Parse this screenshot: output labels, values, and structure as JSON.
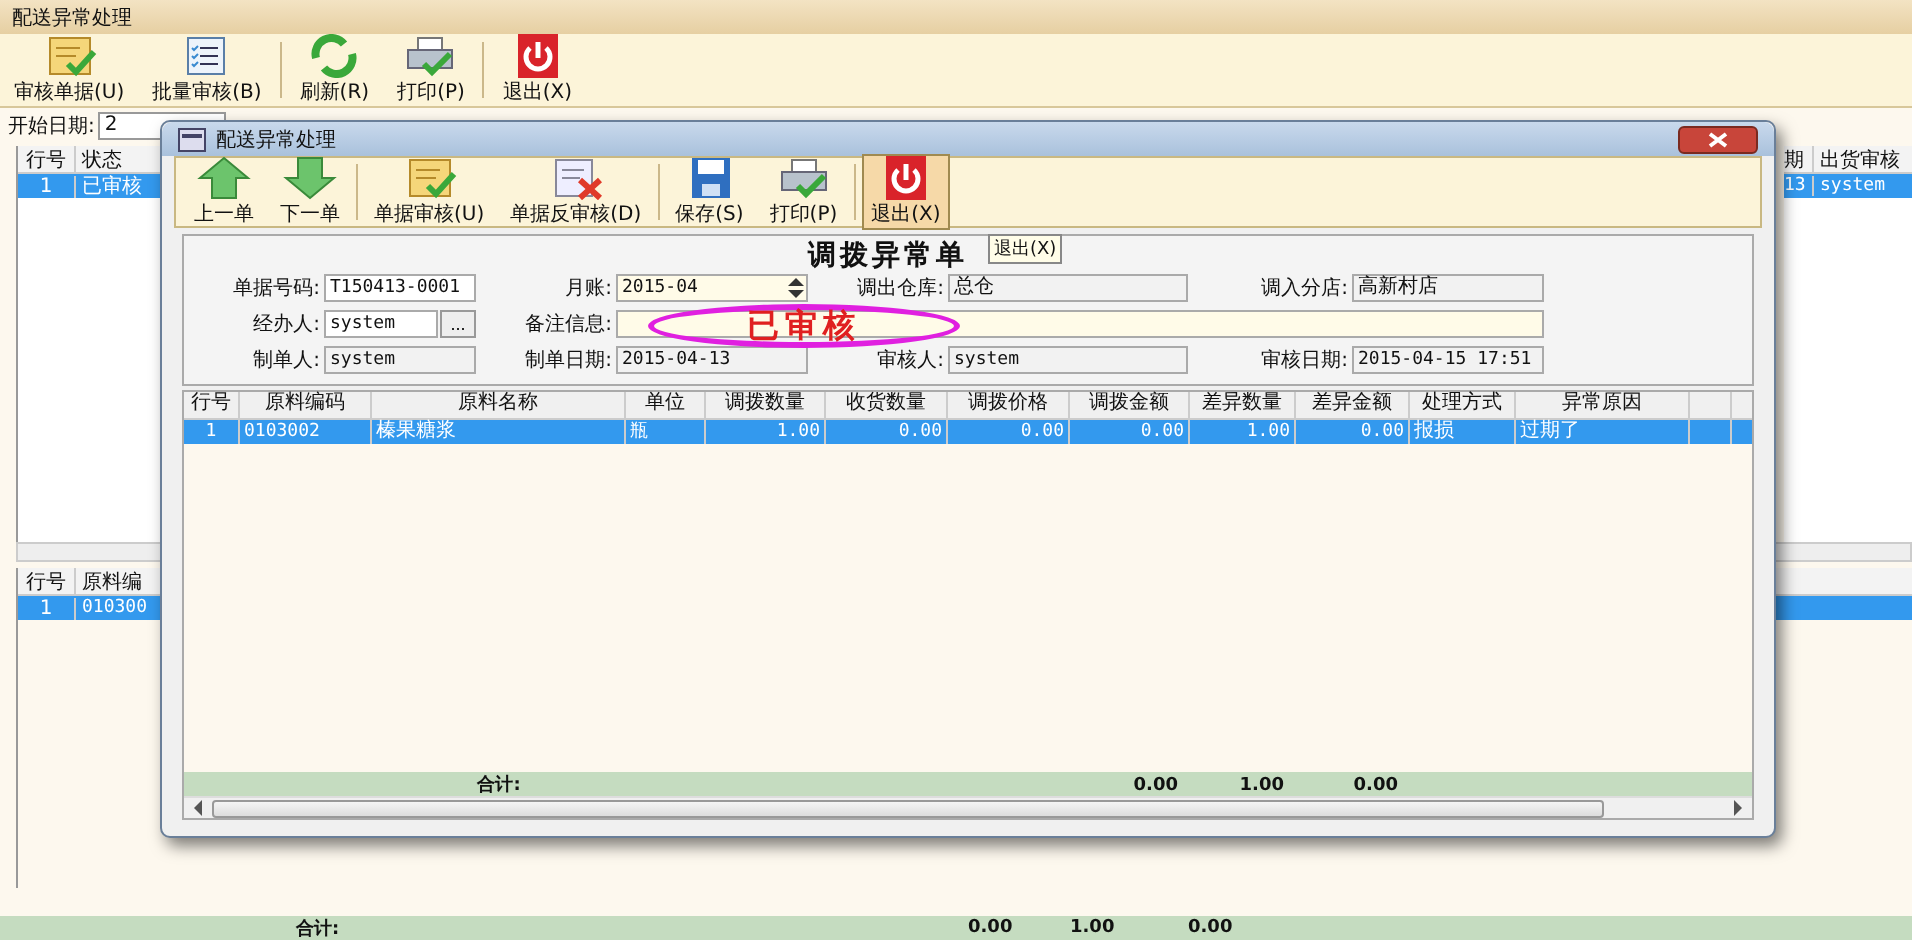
{
  "main_window": {
    "title": "配送异常处理",
    "toolbar": [
      {
        "label": "审核单据(U)",
        "kind": "approve"
      },
      {
        "label": "批量审核(B)",
        "kind": "list"
      },
      {
        "label": "刷新(R)",
        "kind": "refresh"
      },
      {
        "label": "打印(P)",
        "kind": "print"
      },
      {
        "label": "退出(X)",
        "kind": "power"
      }
    ],
    "filter": {
      "label": "开始日期:",
      "value": "2"
    },
    "list": {
      "left_columns": [
        "行号",
        "状态"
      ],
      "right_columns": [
        "期",
        "出货审核"
      ],
      "rows": [
        {
          "left_cells": [
            "1",
            "已审核"
          ],
          "right_cells": [
            "13",
            "system"
          ],
          "selected": true
        }
      ]
    },
    "detail": {
      "columns": [
        "行号",
        "原料编"
      ],
      "rows": [
        {
          "cells": [
            "1",
            "010300"
          ],
          "selected": true
        }
      ]
    },
    "totals": {
      "label": "合计:",
      "values": [
        "0.00",
        "1.00",
        "0.00"
      ]
    }
  },
  "dialog": {
    "title": "配送异常处理",
    "toolbar": [
      {
        "label": "上一单",
        "kind": "up",
        "hovered": false
      },
      {
        "label": "下一单",
        "kind": "down",
        "hovered": false
      },
      {
        "label": "单据审核(U)",
        "kind": "approve",
        "hovered": false
      },
      {
        "label": "单据反审核(D)",
        "kind": "unapprove",
        "hovered": false
      },
      {
        "label": "保存(S)",
        "kind": "save",
        "hovered": false
      },
      {
        "label": "打印(P)",
        "kind": "print",
        "hovered": false
      },
      {
        "label": "退出(X)",
        "kind": "power",
        "hovered": true
      }
    ],
    "tooltip": "退出(X)",
    "form_title": "调拨异常单",
    "fields": {
      "doc_no": {
        "label": "单据号码:",
        "value": "T150413-0001"
      },
      "month": {
        "label": "月账:",
        "value": "2015-04"
      },
      "out_warehouse": {
        "label": "调出仓库:",
        "value": "总仓"
      },
      "in_store": {
        "label": "调入分店:",
        "value": "高新村店"
      },
      "handler": {
        "label": "经办人:",
        "value": "system",
        "button": "..."
      },
      "remark": {
        "label": "备注信息:"
      },
      "creator": {
        "label": "制单人:",
        "value": "system"
      },
      "create_date": {
        "label": "制单日期:",
        "value": "2015-04-13"
      },
      "auditor": {
        "label": "审核人:",
        "value": "system"
      },
      "audit_date": {
        "label": "审核日期:",
        "value": "2015-04-15 17:51"
      }
    },
    "stamp": "已审核",
    "table": {
      "columns": [
        "行号",
        "原料编码",
        "原料名称",
        "单位",
        "调拨数量",
        "收货数量",
        "调拨价格",
        "调拨金额",
        "差异数量",
        "差异金额",
        "处理方式",
        "异常原因"
      ],
      "rows": [
        {
          "cells": [
            "1",
            "0103002",
            "榛果糖浆",
            "瓶",
            "1.00",
            "0.00",
            "0.00",
            "0.00",
            "1.00",
            "0.00",
            "报损",
            "过期了"
          ],
          "selected": true
        }
      ]
    },
    "totals": {
      "label": "合计:",
      "values": [
        "0.00",
        "1.00",
        "0.00"
      ]
    }
  }
}
